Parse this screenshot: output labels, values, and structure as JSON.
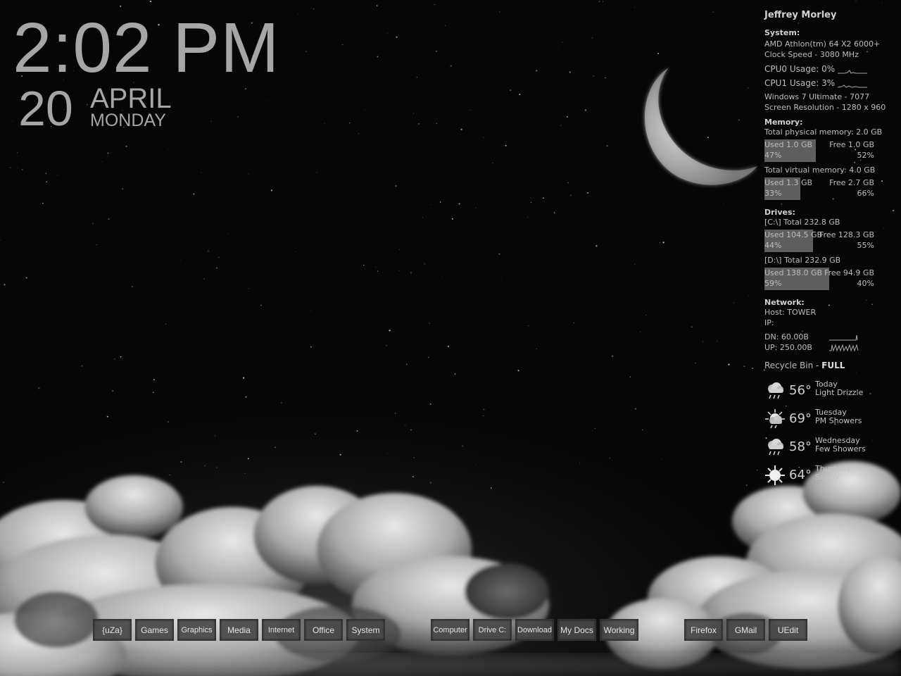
{
  "clock": {
    "time": "2:02 PM",
    "day": "20",
    "month": "APRIL",
    "weekday": "MONDAY"
  },
  "sysmon": {
    "user": "Jeffrey Morley",
    "system_header": "System:",
    "cpu_name": "AMD Athlon(tm) 64 X2 6000+",
    "clock_speed": "Clock Speed - 3080 MHz",
    "cpu0": "CPU0 Usage: 0%",
    "cpu1": "CPU1 Usage: 3%",
    "os": "Windows 7 Ultimate  - 7077",
    "resolution": "Screen Resolution - 1280 x 960",
    "memory_header": "Memory:",
    "physical_total": "Total physical memory: 2.0 GB",
    "physical": {
      "used": "Used 1.0 GB",
      "used_pct": "47%",
      "free": "Free 1.0 GB",
      "free_pct": "52%",
      "fill": 0.47
    },
    "virtual_total": "Total virtual memory: 4.0 GB",
    "virtual": {
      "used": "Used 1.3 GB",
      "used_pct": "33%",
      "free": "Free 2.7 GB",
      "free_pct": "66%",
      "fill": 0.33
    },
    "drives_header": "Drives:",
    "drive_c_total": "[C:\\] Total 232.8 GB",
    "drive_c": {
      "used": "Used 104.5 GB",
      "used_pct": "44%",
      "free": "Free 128.3 GB",
      "free_pct": "55%",
      "fill": 0.44
    },
    "drive_d_total": "[D:\\] Total 232.9 GB",
    "drive_d": {
      "used": "Used 138.0 GB",
      "used_pct": "59%",
      "free": "Free 94.9 GB",
      "free_pct": "40%",
      "fill": 0.59
    },
    "network_header": "Network:",
    "host": "Host: TOWER",
    "ip": "IP:",
    "down": "DN:   60.00B",
    "up": "UP:   250.00B",
    "recycle_label": "Recycle Bin - ",
    "recycle_state": "FULL"
  },
  "weather": [
    {
      "temp": "56°",
      "day": "Today",
      "condition": "Light Drizzle",
      "icon": "rain-cloud-icon"
    },
    {
      "temp": "69°",
      "day": "Tuesday",
      "condition": "PM Showers",
      "icon": "sun-rain-icon"
    },
    {
      "temp": "58°",
      "day": "Wednesday",
      "condition": "Few Showers",
      "icon": "rain-cloud-icon"
    },
    {
      "temp": "64°",
      "day": "Thursday",
      "condition": "Sunny",
      "icon": "sun-icon"
    }
  ],
  "launcher": {
    "groups": [
      [
        "{uZa}",
        "Games",
        "Graphics",
        "Media",
        "Internet",
        "Office",
        "System"
      ],
      [
        "Computer",
        "Drive C:",
        "Download",
        "My Docs",
        "Working"
      ],
      [
        "Firefox",
        "GMail",
        "UEdit"
      ]
    ]
  }
}
